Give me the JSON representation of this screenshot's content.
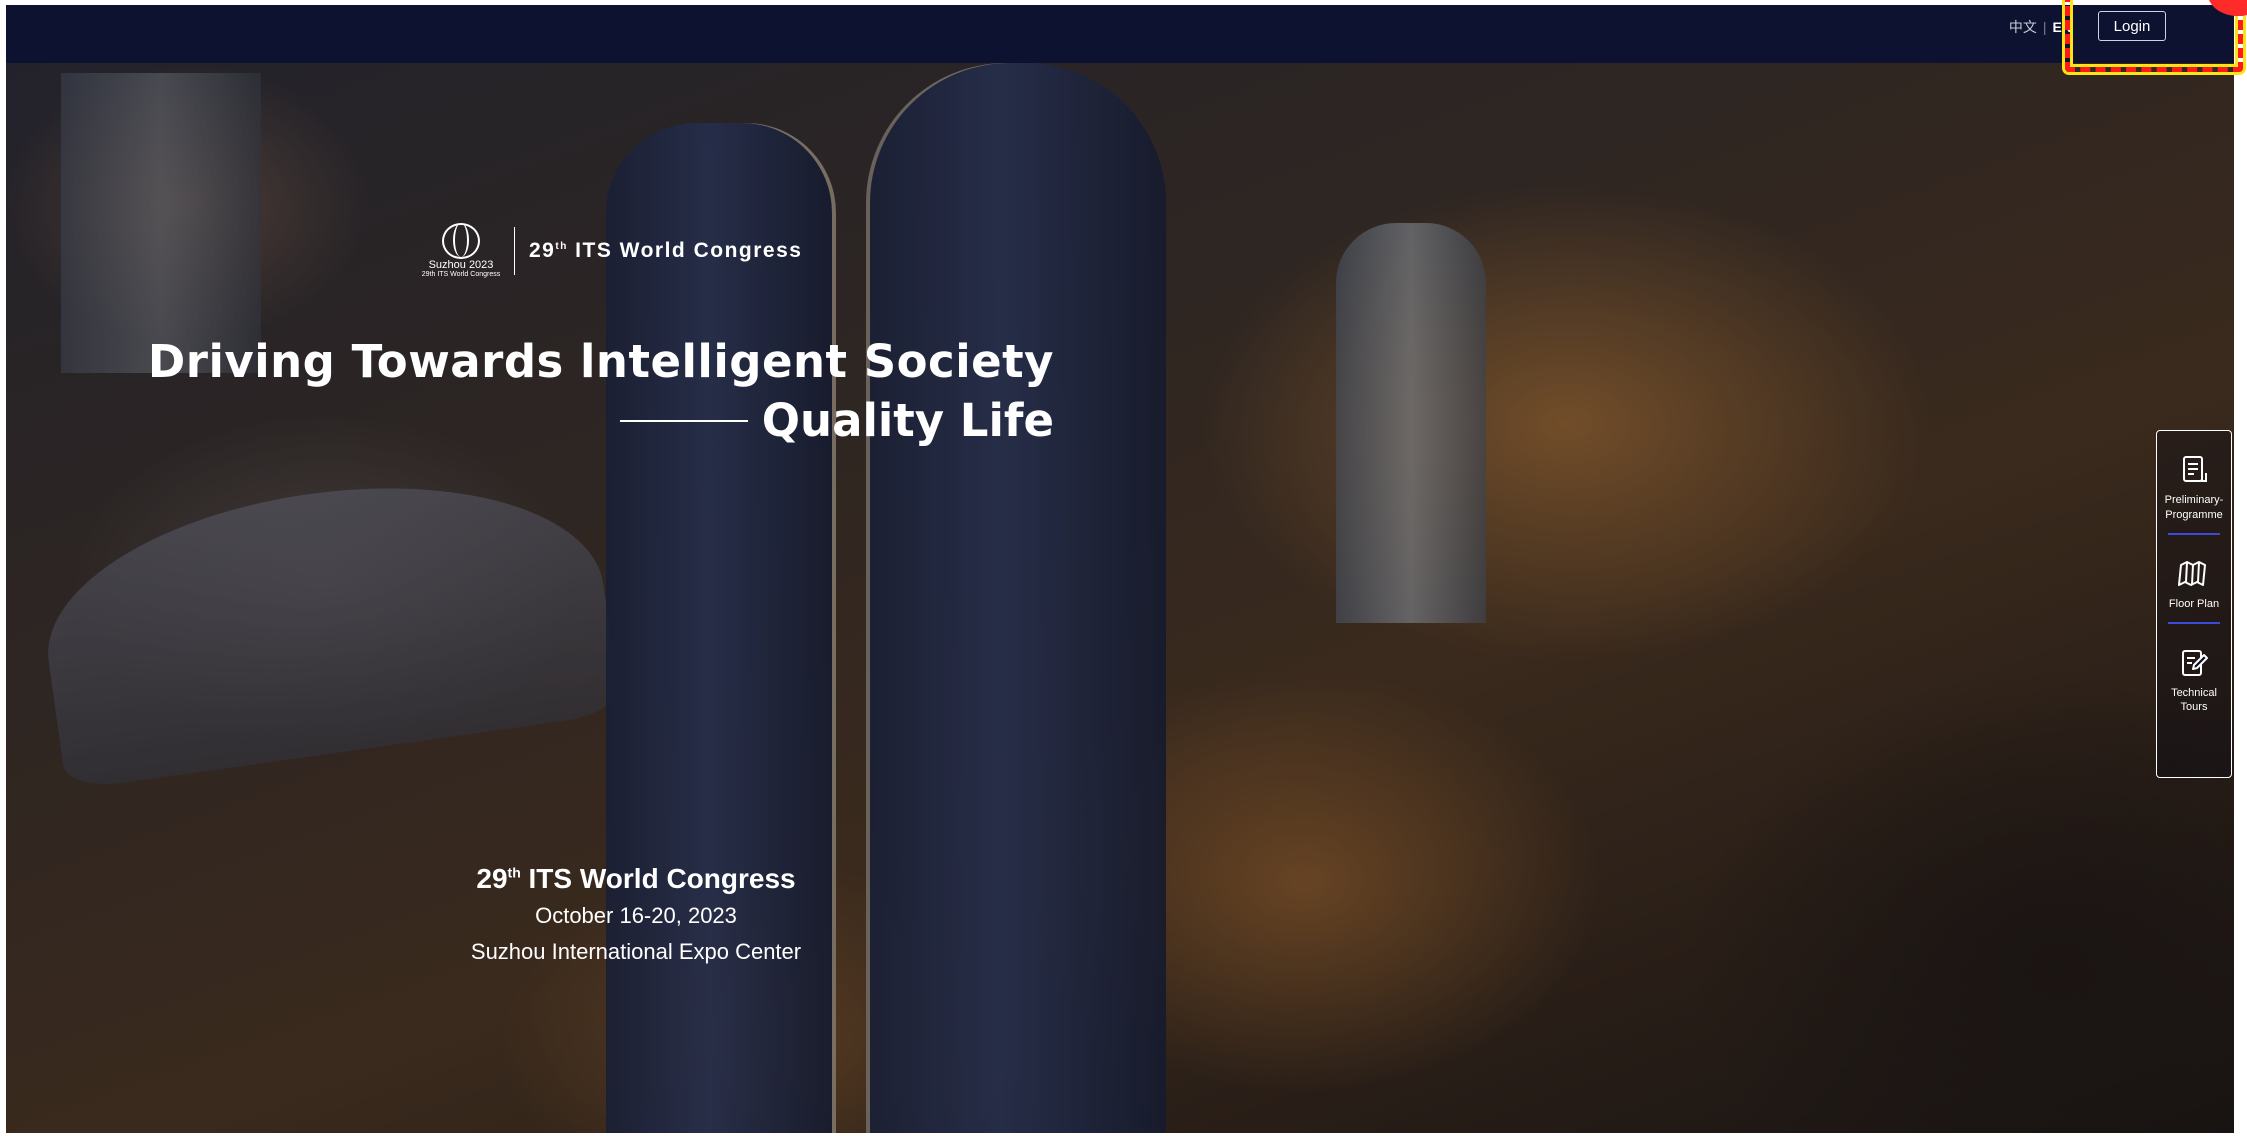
{
  "header": {
    "lang_zh": "中文",
    "lang_separator": "|",
    "lang_en": "EN",
    "login_label": "Login"
  },
  "brand": {
    "logo_text": "Suzhou 2023",
    "logo_subtext": "29th ITS World Congress",
    "title_number": "29",
    "title_suffix": "th",
    "title_text": "ITS World Congress"
  },
  "headline": {
    "line1": "Driving Towards lntelligent Society",
    "line2": "Quality Life"
  },
  "event": {
    "number": "29",
    "suffix": "th",
    "name": "ITS World Congress",
    "date": "October 16-20, 2023",
    "venue": "Suzhou International Expo Center"
  },
  "side_menu": {
    "items": [
      {
        "label": "Preliminary-Programme",
        "icon": "document-icon"
      },
      {
        "label": "Floor Plan",
        "icon": "map-icon"
      },
      {
        "label": "Technical Tours",
        "icon": "edit-document-icon"
      }
    ]
  },
  "colors": {
    "topbar": "#0d1231",
    "highlight_dash": "#ff1a1a",
    "highlight_fill": "#ffe312",
    "menu_separator": "#3a4bd8"
  }
}
